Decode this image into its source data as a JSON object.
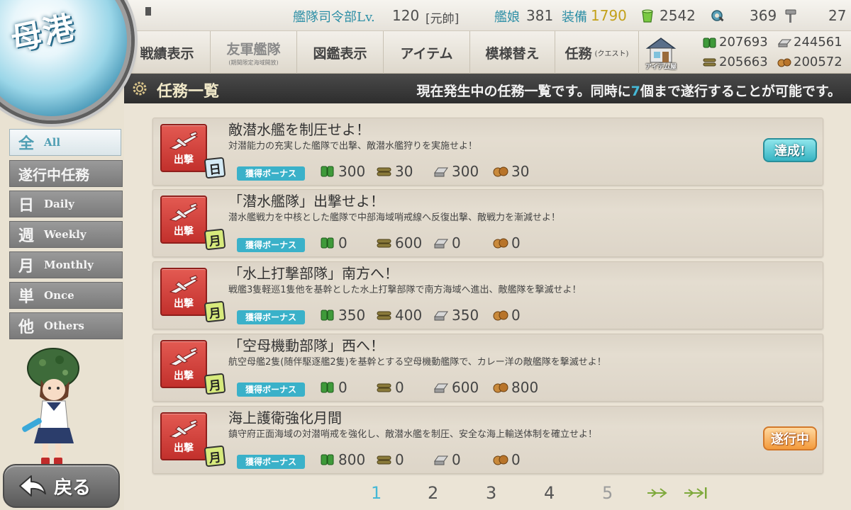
{
  "home_badge": {
    "label": "母港"
  },
  "header": {
    "admiral_label": "艦隊司令部Lv.",
    "admiral_level": "120",
    "rank": "[元帥]",
    "ships_label": "艦娘",
    "ships_count": "381",
    "equip_label": "装備",
    "equip_count": "1790",
    "bucket_count": "2542",
    "devmat_count": "369",
    "screw_count": "27"
  },
  "nav": {
    "items": [
      {
        "label": "戦績表示",
        "sub": ""
      },
      {
        "label": "友軍艦隊",
        "sub": "(期間限定海域開放)"
      },
      {
        "label": "図鑑表示",
        "sub": ""
      },
      {
        "label": "アイテム",
        "sub": ""
      },
      {
        "label": "模様替え",
        "sub": ""
      },
      {
        "label": "任務",
        "sub": "(クエスト)"
      }
    ],
    "item_shop_label": "アイテム屋"
  },
  "materials": {
    "fuel": "207693",
    "steel": "244561",
    "ammo": "205663",
    "bauxite": "200572"
  },
  "title_bar": {
    "title": "任務一覧",
    "desc_before": "現在発生中の任務一覧です。同時に",
    "desc_count": "7",
    "desc_after": "個まで遂行することが可能です。"
  },
  "side_tabs": [
    {
      "kanji": "全",
      "en": "All"
    },
    {
      "full": "遂行中任務"
    },
    {
      "kanji": "日",
      "en": "Daily"
    },
    {
      "kanji": "週",
      "en": "Weekly"
    },
    {
      "kanji": "月",
      "en": "Monthly"
    },
    {
      "kanji": "単",
      "en": "Once"
    },
    {
      "kanji": "他",
      "en": "Others"
    }
  ],
  "quests": [
    {
      "category": "出撃",
      "freq": "日",
      "title": "敵潜水艦を制圧せよ！",
      "desc": "対潜能力の充実した艦隊で出撃、敵潜水艦狩りを実施せよ！",
      "bonus": "獲得ボーナス",
      "fuel": "300",
      "ammo": "30",
      "steel": "300",
      "bauxite": "30",
      "status": "達成!"
    },
    {
      "category": "出撃",
      "freq": "月",
      "title": "「潜水艦隊」出撃せよ！",
      "desc": "潜水艦戦力を中核とした艦隊で中部海域哨戒線へ反復出撃、敵戦力を漸減せよ！",
      "bonus": "獲得ボーナス",
      "fuel": "0",
      "ammo": "600",
      "steel": "0",
      "bauxite": "0",
      "status": ""
    },
    {
      "category": "出撃",
      "freq": "月",
      "title": "「水上打撃部隊」南方へ！",
      "desc": "戦艦3隻軽巡1隻他を基幹とした水上打撃部隊で南方海域へ進出、敵艦隊を撃滅せよ！",
      "bonus": "獲得ボーナス",
      "fuel": "350",
      "ammo": "400",
      "steel": "350",
      "bauxite": "0",
      "status": ""
    },
    {
      "category": "出撃",
      "freq": "月",
      "title": "「空母機動部隊」西へ！",
      "desc": "航空母艦2隻(随伴駆逐艦2隻)を基幹とする空母機動艦隊で、カレー洋の敵艦隊を撃滅せよ！",
      "bonus": "獲得ボーナス",
      "fuel": "0",
      "ammo": "0",
      "steel": "600",
      "bauxite": "800",
      "status": ""
    },
    {
      "category": "出撃",
      "freq": "月",
      "title": "海上護衛強化月間",
      "desc": "鎮守府正面海域の対潜哨戒を強化し、敵潜水艦を制圧、安全な海上輸送体制を確立せよ！",
      "bonus": "獲得ボーナス",
      "fuel": "800",
      "ammo": "0",
      "steel": "0",
      "bauxite": "0",
      "status": "遂行中"
    }
  ],
  "pagination": {
    "pages": [
      "1",
      "2",
      "3",
      "4",
      "5"
    ],
    "current": "1"
  },
  "back_button": {
    "label": "戻る"
  },
  "colors": {
    "accent": "#45b8d6",
    "achieved": "#37b4c3",
    "in_progress": "#f39a3c",
    "sortie": "#c2302c",
    "monthly_tag": "#d7ea7c",
    "daily_tag": "#d5ebf6"
  }
}
